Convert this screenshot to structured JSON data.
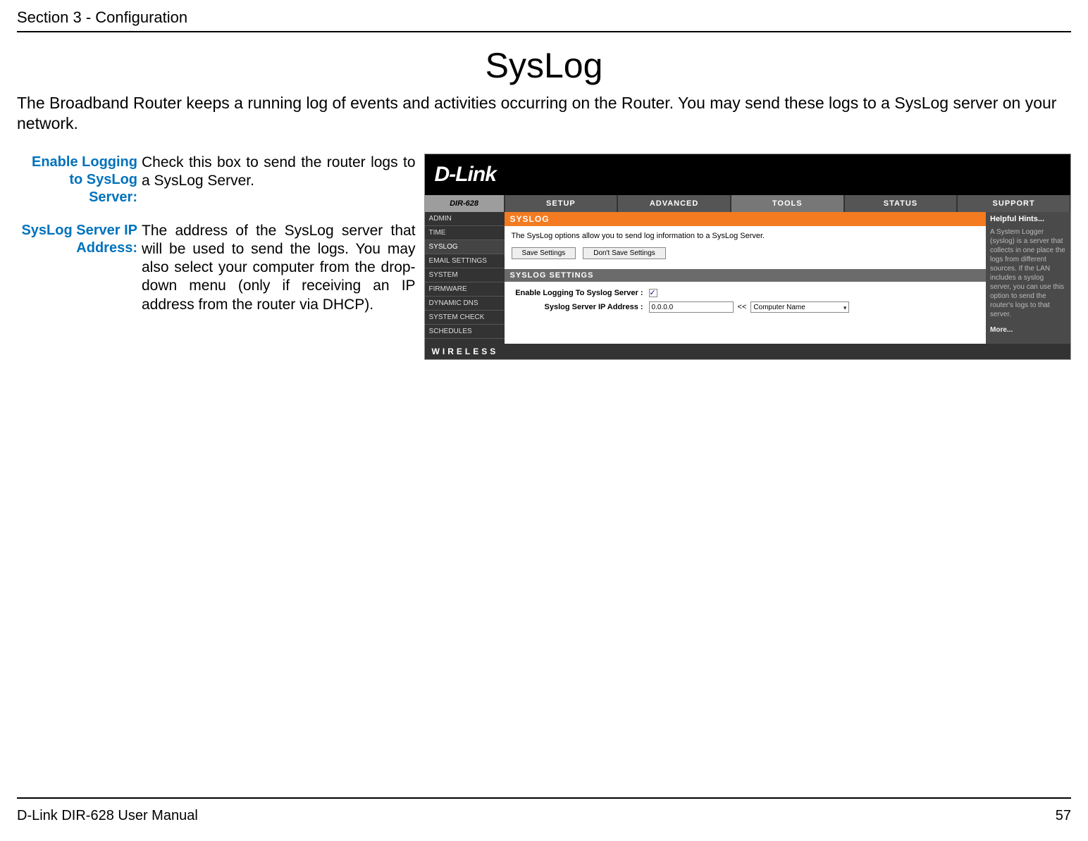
{
  "header": {
    "section": "Section 3 - Configuration"
  },
  "title": "SysLog",
  "intro": "The Broadband Router keeps a running log of events and activities occurring on the Router. You may send these logs to a SysLog server on your network.",
  "definitions": [
    {
      "label": "Enable Logging to SysLog Server:",
      "text": "Check this box to send the router logs to a SysLog Server."
    },
    {
      "label": "SysLog Server IP Address:",
      "text": "The address of the SysLog server that will be used to send the logs. You may also select your computer from the drop-down menu (only if receiving an IP address from the router via DHCP)."
    }
  ],
  "shot": {
    "brand": "D-Link",
    "model": "DIR-628",
    "tabs": [
      "SETUP",
      "ADVANCED",
      "TOOLS",
      "STATUS",
      "SUPPORT"
    ],
    "tabs_selected_index": 2,
    "sidebar": [
      "ADMIN",
      "TIME",
      "SYSLOG",
      "EMAIL SETTINGS",
      "SYSTEM",
      "FIRMWARE",
      "DYNAMIC DNS",
      "SYSTEM CHECK",
      "SCHEDULES"
    ],
    "sidebar_selected_index": 2,
    "panel_title": "SYSLOG",
    "panel_desc": "The SysLog options allow you to send log information to a SysLog Server.",
    "btn_save": "Save Settings",
    "btn_cancel": "Don't Save Settings",
    "settings_title": "SYSLOG SETTINGS",
    "field_enable_label": "Enable Logging To Syslog Server :",
    "field_enable_checked": true,
    "field_ip_label": "Syslog Server IP Address :",
    "field_ip_value": "0.0.0.0",
    "field_ip_sep": "<<",
    "field_ip_select": "Computer Name",
    "hints_title": "Helpful Hints...",
    "hints_body": "A System Logger (syslog) is a server that collects in one place the logs from different sources. If the LAN includes a syslog server, you can use this option to send the router's logs to that server.",
    "hints_more": "More...",
    "wireless": "WIRELESS"
  },
  "footer": {
    "left": "D-Link DIR-628 User Manual",
    "right": "57"
  }
}
